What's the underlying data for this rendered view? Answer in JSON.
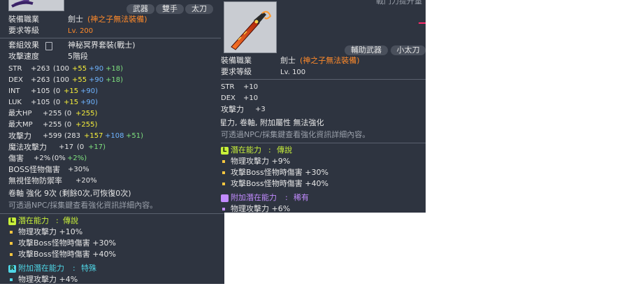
{
  "left": {
    "tags": [
      "武器",
      "雙手",
      "太刀"
    ],
    "job_label": "裝備職業",
    "job_value": "劍士",
    "job_note": "(神之子無法裝備)",
    "level_label": "要求等級",
    "level_value": "Lv. 200",
    "set_label": "套組效果",
    "set_value": "神秘冥界套裝(戰士)",
    "speed_label": "攻擊速度",
    "speed_value": "5階段",
    "stats": [
      {
        "name": "STR",
        "total": "+263",
        "base": "(100",
        "a": "+55",
        "b": "+90",
        "c": "+18)"
      },
      {
        "name": "DEX",
        "total": "+263",
        "base": "(100",
        "a": "+55",
        "b": "+90",
        "c": "+18)"
      },
      {
        "name": "INT",
        "total": "+105",
        "base": "(0",
        "a": "+15",
        "b": "+90)",
        "c": ""
      },
      {
        "name": "LUK",
        "total": "+105",
        "base": "(0",
        "a": "+15",
        "b": "+90)",
        "c": ""
      },
      {
        "name": "最大HP",
        "total": "+255",
        "base": "(0",
        "a": "+255)",
        "b": "",
        "c": ""
      },
      {
        "name": "最大MP",
        "total": "+255",
        "base": "(0",
        "a": "+255)",
        "b": "",
        "c": ""
      },
      {
        "name": "攻擊力",
        "total": "+599",
        "base": "(283",
        "a": "+157",
        "b": "+108",
        "c": "+51)"
      }
    ],
    "matk_label": "魔法攻擊力",
    "matk_total": "+17",
    "matk_base": "(0",
    "matk_green": "+17)",
    "dmg_label": "傷害",
    "dmg_total": "+2%",
    "dmg_base": "(0%",
    "dmg_green": "+2%)",
    "boss_label": "BOSS怪物傷害",
    "boss_value": "+30%",
    "ignore_label": "無視怪物防禦率",
    "ignore_value": "+20%",
    "scroll_line": "卷軸 強化 9次 (剩餘0次,可恢復0次)",
    "hint": "可透過NPC/採集鍵查看強化資訊詳細內容。",
    "pot_title": "潛在能力",
    "pot_colon": ":",
    "pot_grade": "傳說",
    "pot_badge": "L",
    "pot_lines": [
      "物理攻擊力 +10%",
      "攻擊Boss怪物時傷害 +30%",
      "攻擊Boss怪物時傷害 +40%"
    ],
    "add_title": "附加潛在能力",
    "add_colon": ":",
    "add_grade": "特殊",
    "add_badge": "R",
    "add_lines": [
      "物理攻擊力 +4%"
    ]
  },
  "right": {
    "top_cut": "戰鬥力提升量",
    "tags": [
      "輔助武器",
      "小太刀"
    ],
    "job_label": "裝備職業",
    "job_value": "劍士",
    "job_note": "(神之子無法裝備)",
    "level_label": "要求等級",
    "level_value": "Lv. 100",
    "stats": [
      {
        "name": "STR",
        "value": "+10"
      },
      {
        "name": "DEX",
        "value": "+10"
      },
      {
        "name": "攻擊力",
        "value": "+3"
      }
    ],
    "flags": "星力, 卷軸, 附加屬性 無法強化",
    "hint": "可透過NPC/採集鍵查看強化資訊詳細內容。",
    "pot_title": "潛在能力",
    "pot_colon": ":",
    "pot_grade": "傳說",
    "pot_badge": "L",
    "pot_lines": [
      "物理攻擊力 +9%",
      "攻擊Boss怪物時傷害 +30%",
      "攻擊Boss怪物時傷害 +40%"
    ],
    "add_title": "附加潛在能力",
    "add_colon": ":",
    "add_grade": "稀有",
    "add_lines": [
      "物理攻擊力 +6%"
    ]
  },
  "colors": {
    "panel": "#2e3440",
    "orange": "#ff8a2a",
    "yellow": "#f6ee3a",
    "blue": "#6fb4ff",
    "green": "#7ee07e",
    "legendary": "#c8f03a",
    "special": "#4fd6e6",
    "rare": "#c28bff"
  }
}
